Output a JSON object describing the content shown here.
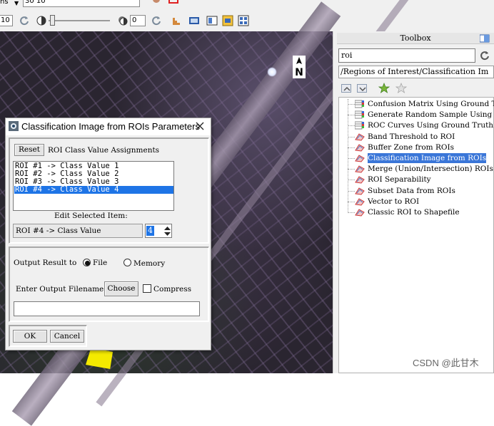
{
  "toolbar": {
    "menu_fragment": "ns",
    "combo_value": "30 10",
    "zoom_value": "10",
    "slider2_value": "0"
  },
  "toolbox": {
    "title": "Toolbox",
    "search_value": "roi",
    "path": "/Regions of Interest/Classification Im",
    "items": [
      {
        "label": "Confusion Matrix Using Ground T",
        "icon": "table-icon"
      },
      {
        "label": "Generate Random Sample Using Gr",
        "icon": "table-icon"
      },
      {
        "label": "ROC Curves Using Ground Truth R",
        "icon": "table-icon"
      },
      {
        "label": "Band Threshold to ROI",
        "icon": "roi-tool-icon"
      },
      {
        "label": "Buffer Zone from ROIs",
        "icon": "roi-tool-icon"
      },
      {
        "label": "Classification Image from ROIs",
        "icon": "roi-tool-icon",
        "selected": true
      },
      {
        "label": "Merge (Union/Intersection) ROIs",
        "icon": "roi-tool-icon"
      },
      {
        "label": "ROI Separability",
        "icon": "roi-tool-icon"
      },
      {
        "label": "Subset Data from ROIs",
        "icon": "roi-tool-icon"
      },
      {
        "label": "Vector to ROI",
        "icon": "roi-tool-icon"
      },
      {
        "label": "Classic ROI to Shapefile",
        "icon": "roi-tool-icon"
      }
    ]
  },
  "dialog": {
    "title": "Classification Image from ROIs Parameters",
    "reset_label": "Reset",
    "assign_label": "ROI Class Value Assignments",
    "roi_items": [
      "ROI #1 -> Class Value 1",
      "ROI #2 -> Class Value 2",
      "ROI #3 -> Class Value 3",
      "ROI #4 -> Class Value 4"
    ],
    "selected_index": 3,
    "edit_label": "Edit Selected Item:",
    "edit_text": "ROI #4 -> Class Value",
    "edit_value": "4",
    "output_label": "Output Result to",
    "file_label": "File",
    "memory_label": "Memory",
    "filename_label": "Enter Output Filename",
    "choose_label": "Choose",
    "compress_label": "Compress",
    "filename_value": "",
    "ok_label": "OK",
    "cancel_label": "Cancel"
  },
  "viewer": {
    "north_label": "N"
  },
  "watermark": "CSDN @此甘木"
}
